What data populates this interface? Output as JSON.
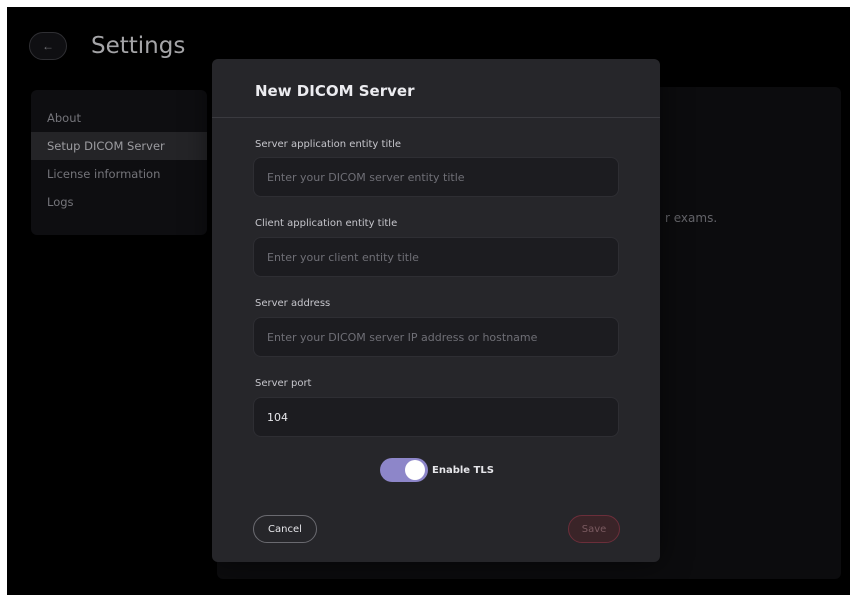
{
  "page": {
    "title": "Settings",
    "back_icon": "arrow-left-icon",
    "background_fragment": "r exams."
  },
  "sidebar": {
    "items": [
      {
        "label": "About"
      },
      {
        "label": "Setup DICOM Server",
        "active": true
      },
      {
        "label": "License information"
      },
      {
        "label": "Logs"
      }
    ]
  },
  "modal": {
    "title": "New DICOM Server",
    "fields": [
      {
        "label": "Server application entity title",
        "placeholder": "Enter your DICOM server entity title",
        "value": ""
      },
      {
        "label": "Client application entity title",
        "placeholder": "Enter your client entity title",
        "value": ""
      },
      {
        "label": "Server address",
        "placeholder": "Enter your DICOM server IP address or hostname",
        "value": ""
      },
      {
        "label": "Server port",
        "placeholder": "",
        "value": "104"
      }
    ],
    "tls": {
      "label": "Enable TLS",
      "enabled": true
    },
    "cancel_label": "Cancel",
    "save_label": "Save"
  },
  "colors": {
    "toggle_on": "#8d86c9",
    "save_border": "#6b2e3a",
    "modal_bg": "#26262a"
  }
}
